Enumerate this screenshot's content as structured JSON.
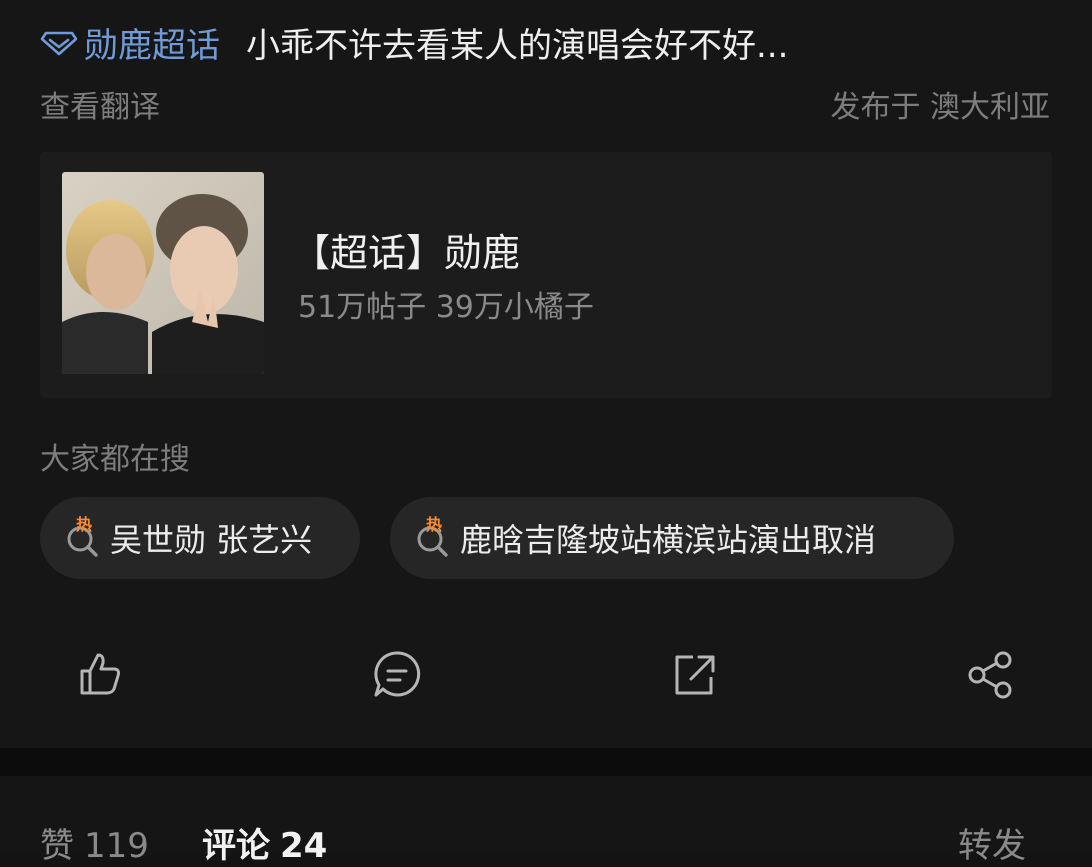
{
  "post": {
    "topic_tag": "勋鹿超话",
    "text": "小乖不许去看某人的演唱会好不好...",
    "translate_label": "查看翻译",
    "location": "发布于 澳大利亚"
  },
  "topic_card": {
    "title": "【超话】勋鹿",
    "stats": "51万帖子 39万小橘子"
  },
  "search": {
    "heading": "大家都在搜",
    "hot_badge": "热",
    "items": [
      {
        "label": "吴世勋 张艺兴"
      },
      {
        "label": "鹿晗吉隆坡站横滨站演出取消"
      }
    ]
  },
  "actions": [
    "thumbs-up-icon",
    "comment-icon",
    "share-out-icon",
    "share-icon"
  ],
  "tabs": {
    "likes": {
      "label": "赞",
      "count": "119"
    },
    "comments": {
      "label": "评论",
      "count": "24"
    },
    "reposts": {
      "label": "转发"
    }
  },
  "colors": {
    "accent_link": "#6f9bd9",
    "hot": "#ff8c2e",
    "background": "#161616"
  }
}
